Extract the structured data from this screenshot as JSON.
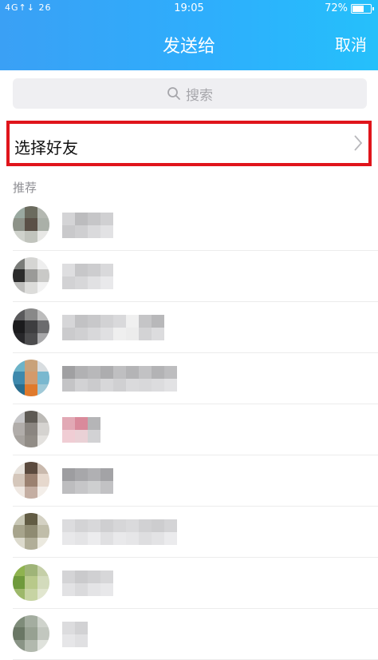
{
  "status_bar": {
    "signal": "4G↑↓ 26",
    "time": "19:05",
    "battery": "72%",
    "battery_level": 0.72
  },
  "header": {
    "title": "发送给",
    "cancel_label": "取消"
  },
  "search": {
    "placeholder": "搜索"
  },
  "select_friends": {
    "label": "选择好友"
  },
  "section": {
    "title": "推荐"
  },
  "colors": {
    "header_start": "#3aa0f5",
    "header_end": "#25c0fb",
    "highlight_border": "#e0141b"
  },
  "contacts": [
    {
      "avatar": [
        "#9aa9a0",
        "#6b6b5e",
        "#b4b8b1",
        "#8d9288",
        "#5a5046",
        "#aab0a8",
        "#cfd2cc",
        "#c1c4bd",
        "#e8e8e6"
      ],
      "name": [
        "#d4d4d6",
        "#c9c9cb",
        "#bcbcbe",
        "#cfcfd1",
        "#c6c6c8",
        "#dadadc",
        "#d0d0d2",
        "#e2e2e4"
      ]
    },
    {
      "avatar": [
        "#7a7c79",
        "#d5d5d3",
        "#eeeeee",
        "#2b2b2b",
        "#9a9a98",
        "#c9c9c7",
        "#bdbdbb",
        "#dcdcda",
        "#f2f2f2"
      ],
      "name": [
        "#dedee0",
        "#d2d2d4",
        "#c7c7c9",
        "#d7d7d9",
        "#cdcdcf",
        "#e1e1e3",
        "#d9d9db",
        "#e9e9eb"
      ]
    },
    {
      "avatar": [
        "#5a5a5c",
        "#888888",
        "#bcbcbc",
        "#1b1b1d",
        "#3e3e40",
        "#6c6c6e",
        "#27272a",
        "#4c4c4e",
        "#a8a8aa"
      ],
      "name": [
        "#d6d6d8",
        "#cbcbcd",
        "#c2c2c4",
        "#d0d0d2",
        "#c8c8ca",
        "#d8d8da",
        "#d2d2d4",
        "#e0e0e2",
        "#d9d9db",
        "#efefef",
        "#f0f0f0",
        "#ececec",
        "#c5c5c7",
        "#d3d3d5",
        "#b8b8ba",
        "#dcdcde"
      ]
    },
    {
      "avatar": [
        "#6cb3c8",
        "#c9a27a",
        "#d8dde0",
        "#3e89ad",
        "#d49a6b",
        "#7ab8cf",
        "#2a6d8e",
        "#e07a2c",
        "#a0c9d7"
      ],
      "name": [
        "#a0a0a2",
        "#c4c4c6",
        "#b1b1b3",
        "#d2d2d4",
        "#b8b8ba",
        "#cbcbcd",
        "#adadaf",
        "#d7d7d9",
        "#bfbfc1",
        "#d0d0d2",
        "#b4b4b6",
        "#dadadc",
        "#c2c2c4",
        "#d8d8da",
        "#b3b3b5",
        "#dcdcde",
        "#bdbdbf",
        "#e2e2e4"
      ]
    },
    {
      "avatar": [
        "#c7c7c9",
        "#5e5a54",
        "#bcbab6",
        "#b1adaa",
        "#8a8580",
        "#d5d3d0",
        "#a7a39f",
        "#918c86",
        "#e3e1de"
      ],
      "name": [
        "#e2a9b5",
        "#f0cdd4",
        "#d98a9b",
        "#ead1d6",
        "#b5b5b7",
        "#d2d2d4"
      ]
    },
    {
      "avatar": [
        "#e8e3dd",
        "#5b4a3e",
        "#c9b9ad",
        "#d5c7bb",
        "#9b8170",
        "#e6d8cd",
        "#efe8e2",
        "#c4aea2",
        "#f3eee9"
      ],
      "name": [
        "#9d9da0",
        "#bdbdbf",
        "#a7a7aa",
        "#c6c6c8",
        "#b0b0b3",
        "#cecfd0",
        "#a3a3a6",
        "#c2c2c4"
      ]
    },
    {
      "avatar": [
        "#c9c8b6",
        "#625c44",
        "#d4d1c3",
        "#a7a48c",
        "#8f8b72",
        "#c0bda9",
        "#dcdacd",
        "#b1ae98",
        "#ebe9df"
      ],
      "name": [
        "#dcdcde",
        "#e8e8ea",
        "#d3d3d5",
        "#e4e4e6",
        "#d8d8da",
        "#ececee",
        "#cfcfd1",
        "#e0e0e2",
        "#d6d6d8",
        "#e9e9eb",
        "#dadadc",
        "#e6e6e8",
        "#d1d1d3",
        "#dedee0",
        "#cdcdcf",
        "#e3e3e5",
        "#d4d4d6",
        "#ebebed"
      ]
    },
    {
      "avatar": [
        "#8fb34f",
        "#9fb478",
        "#c5cfa8",
        "#6f9a3c",
        "#b8c98a",
        "#d3dbbc",
        "#9db86a",
        "#c7d4a3",
        "#e1e6cf"
      ],
      "name": [
        "#d4d4d6",
        "#e2e2e4",
        "#cacacc",
        "#dadadc",
        "#d0d0d2",
        "#e4e4e6",
        "#d7d7d9",
        "#e8e8ea"
      ]
    },
    {
      "avatar": [
        "#7f8c7a",
        "#a4ada0",
        "#cfd3cc",
        "#6a7765",
        "#97a192",
        "#c2c7bf",
        "#8a9486",
        "#b2b9ae",
        "#dfe2dc"
      ],
      "name": [
        "#dcdcde",
        "#e6e6e8",
        "#d2d2d4",
        "#e0e0e2"
      ]
    }
  ]
}
